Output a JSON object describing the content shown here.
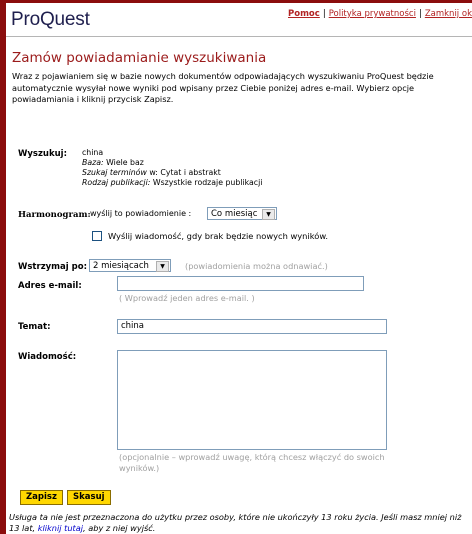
{
  "logo": "ProQuest",
  "top_links": {
    "help": "Pomoc",
    "privacy": "Polityka prywatności",
    "close": "Zamknij okno"
  },
  "title": "Zamów powiadamianie wyszukiwania",
  "intro": "Wraz z pojawianiem się w bazie nowych dokumentów odpowiadających wyszukiwaniu ProQuest będzie automatycznie wysyłał nowe wyniki pod wpisany przez Ciebie poniżej adres e-mail. Wybierz opcje powiadamiania i kliknij przycisk Zapisz.",
  "search": {
    "label": "Wyszukuj:",
    "query": "china",
    "db_label": "Baza:",
    "db_value": "Wiele baz",
    "terms_label": "Szukaj terminów",
    "terms_in": "w:",
    "terms_value": "Cytat i abstrakt",
    "pubtype_label": "Rodzaj publikacji:",
    "pubtype_value": "Wszystkie rodzaje publikacji"
  },
  "schedule": {
    "label": "Harmonogram:",
    "sublabel": "wyślij to powiadomienie :",
    "selected": "Co miesiąc",
    "checkbox_label": "Wyślij wiadomość, gdy brak będzie nowych wyników."
  },
  "stop": {
    "label": "Wstrzymaj po:",
    "selected": "2 miesiącach",
    "note": "(powiadomienia można odnawiać.)"
  },
  "email": {
    "label": "Adres  e-mail:",
    "value": "",
    "hint": "( Wprowadź jeden adres e-mail. )"
  },
  "subject": {
    "label": "Temat:",
    "value": "china"
  },
  "message": {
    "label": "Wiadomość:",
    "value": "",
    "hint": "(opcjonalnie – wprowadź uwagę, którą chcesz włączyć do swoich wyników.)"
  },
  "buttons": {
    "save": "Zapisz",
    "cancel": "Skasuj"
  },
  "footer": {
    "text": "Usługa ta nie jest przeznaczona do użytku przez osoby, które nie ukończyły 13 roku życia. Jeśli masz mniej niż 13 lat,",
    "link": "kliknij tutaj",
    "tail": ", aby z niej wyjść."
  },
  "colors": {
    "frame": "#8b0d0d",
    "title": "#9b1b1b",
    "button": "#ffd700",
    "link": "#0000cc"
  }
}
